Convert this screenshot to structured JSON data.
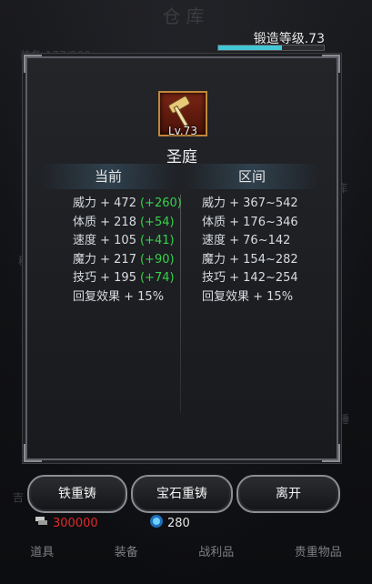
{
  "background": {
    "title": "仓库",
    "slot_info": "装备 177/200",
    "side_texts": [
      "秘",
      "吉",
      "锤",
      "库"
    ]
  },
  "forge": {
    "label": "锻造等级.73",
    "progress": 0.6
  },
  "item": {
    "icon": "hammer-icon",
    "level": "Lv.73",
    "name": "圣庭"
  },
  "columns": {
    "current": "当前",
    "range": "区间"
  },
  "current_stats": [
    {
      "label": "威力 + 472",
      "bonus": "(+260)"
    },
    {
      "label": "体质 + 218",
      "bonus": "(+54)"
    },
    {
      "label": "速度 + 105",
      "bonus": "(+41)"
    },
    {
      "label": "魔力 + 217",
      "bonus": "(+90)"
    },
    {
      "label": "技巧 + 195",
      "bonus": "(+74)"
    },
    {
      "label": "回复效果 + 15%",
      "bonus": ""
    }
  ],
  "range_stats": [
    "威力 + 367~542",
    "体质 + 176~346",
    "速度 + 76~142",
    "魔力 + 154~282",
    "技巧 + 142~254",
    "回复效果 + 15%"
  ],
  "buttons": {
    "iron_reforge": "铁重铸",
    "gem_reforge": "宝石重铸",
    "leave": "离开"
  },
  "currency": {
    "silver": "300000",
    "gems": "280"
  },
  "tabs": [
    "道具",
    "装备",
    "战利品",
    "贵重物品"
  ],
  "colors": {
    "bonus_green": "#36d14a",
    "silver_red": "#e02a2a",
    "progress_cyan": "#43c7d6"
  }
}
